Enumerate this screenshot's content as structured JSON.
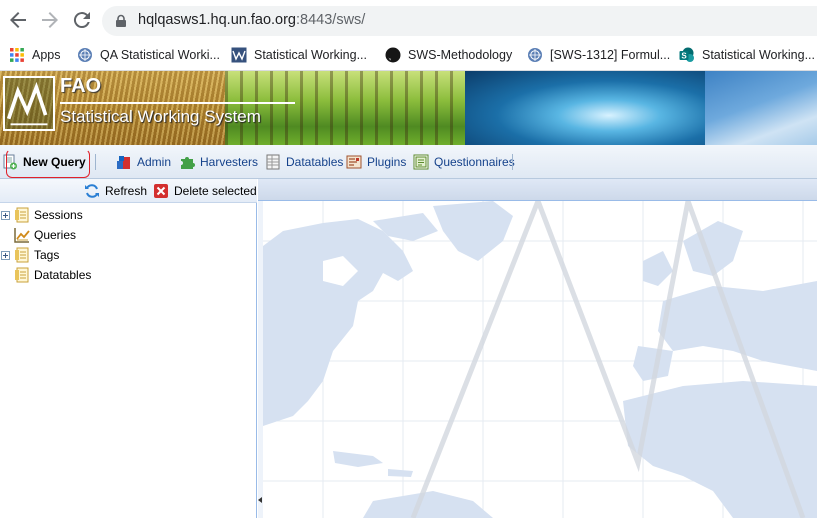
{
  "browser": {
    "url_host": "hqlqasws1.hq.un.fao.org",
    "url_rest": ":8443/sws/",
    "bookmarks": [
      {
        "label": "Apps",
        "icon": "apps-grid-icon"
      },
      {
        "label": "QA Statistical Worki...",
        "icon": "fao-globe-icon"
      },
      {
        "label": "Statistical Working...",
        "icon": "fao-sws-icon"
      },
      {
        "label": "SWS-Methodology",
        "icon": "github-icon"
      },
      {
        "label": "[SWS-1312] Formul...",
        "icon": "fao-globe-icon"
      },
      {
        "label": "Statistical Working...",
        "icon": "sharepoint-icon"
      }
    ]
  },
  "banner": {
    "org": "FAO",
    "system": "Statistical Working System"
  },
  "toolbar": {
    "new_query": "New Query",
    "admin": "Admin",
    "harvesters": "Harvesters",
    "datatables": "Datatables",
    "plugins": "Plugins",
    "questionnaires": "Questionnaires"
  },
  "left_panel": {
    "refresh": "Refresh",
    "delete_selected": "Delete selected",
    "tree": [
      {
        "label": "Sessions",
        "expandable": true,
        "icon": "folder-tree-icon"
      },
      {
        "label": "Queries",
        "expandable": false,
        "icon": "chart-icon"
      },
      {
        "label": "Tags",
        "expandable": true,
        "icon": "folder-tree-icon"
      },
      {
        "label": "Datatables",
        "expandable": false,
        "icon": "folder-tree-icon"
      }
    ]
  },
  "colors": {
    "toolbar_text": "#15428b",
    "annotation": "#e0202a",
    "panel_border": "#99bbe8"
  }
}
